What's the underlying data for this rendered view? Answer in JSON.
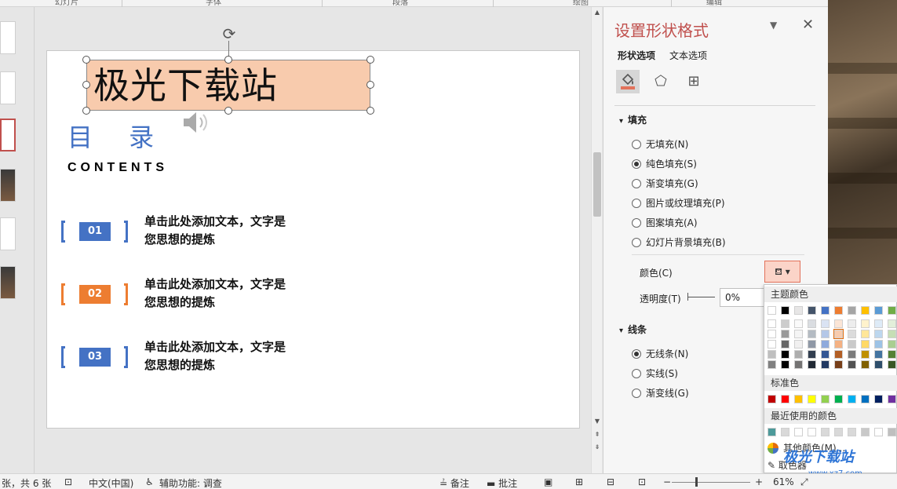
{
  "ribbon": {
    "groups": [
      "幻灯片",
      "字体",
      "段落",
      "绘图",
      "编辑"
    ]
  },
  "slide": {
    "title": "极光下载站",
    "heading": "目 录",
    "subheading": "CONTENTS",
    "items": [
      {
        "num": "01",
        "text_line1": "单击此处添加文本，文字是",
        "text_line2": "您思想的提炼",
        "color": "#4472c4"
      },
      {
        "num": "02",
        "text_line1": "单击此处添加文本，文字是",
        "text_line2": "您思想的提炼",
        "color": "#ed7d31"
      },
      {
        "num": "03",
        "text_line1": "单击此处添加文本，文字是",
        "text_line2": "您思想的提炼",
        "color": "#4472c4"
      }
    ],
    "title_fill": "#f8cbad"
  },
  "pane": {
    "title": "设置形状格式",
    "tabs": [
      "形状选项",
      "文本选项"
    ],
    "icons": [
      "fill-line-icon",
      "effects-pentagon-icon",
      "size-properties-icon"
    ],
    "fill_section": "填充",
    "fill_options": [
      {
        "label": "无填充(N)",
        "checked": false
      },
      {
        "label": "纯色填充(S)",
        "checked": true
      },
      {
        "label": "渐变填充(G)",
        "checked": false
      },
      {
        "label": "图片或纹理填充(P)",
        "checked": false
      },
      {
        "label": "图案填充(A)",
        "checked": false
      },
      {
        "label": "幻灯片背景填充(B)",
        "checked": false
      }
    ],
    "color_label": "颜色(C)",
    "transparency_label": "透明度(T)",
    "transparency_value": "0%",
    "line_section": "线条",
    "line_options": [
      {
        "label": "无线条(N)",
        "checked": true
      },
      {
        "label": "实线(S)",
        "checked": false
      },
      {
        "label": "渐变线(G)",
        "checked": false
      }
    ]
  },
  "color_menu": {
    "theme_header": "主题颜色",
    "standard_header": "标准色",
    "recent_header": "最近使用的颜色",
    "more_colors": "其他颜色(M)...",
    "eyedropper": "取色器",
    "theme_top": [
      "#ffffff",
      "#000000",
      "#e7e6e6",
      "#44546a",
      "#4472c4",
      "#ed7d31",
      "#a5a5a5",
      "#ffc000",
      "#5b9bd5",
      "#70ad47"
    ],
    "standard": [
      "#c00000",
      "#ff0000",
      "#ffc000",
      "#ffff00",
      "#92d050",
      "#00b050",
      "#00b0f0",
      "#0070c0",
      "#002060",
      "#7030a0"
    ],
    "recent": [
      "#4d9a9a",
      "#d9d9d9",
      "#ffffff",
      "#ffffff",
      "#d9d9d9",
      "#d9d9d9",
      "#d9d9d9",
      "#c8c8c8",
      "#ffffff",
      "#bfbfbf"
    ]
  },
  "status": {
    "slide_info": "张，共 6 张",
    "language": "中文(中国)",
    "accessibility": "辅助功能: 调查",
    "notes": "备注",
    "comments": "批注",
    "zoom_minus": "−",
    "zoom_plus": "+",
    "zoom": "61%"
  },
  "watermark": {
    "text": "极光下载站",
    "url": "www.xz7.com"
  }
}
